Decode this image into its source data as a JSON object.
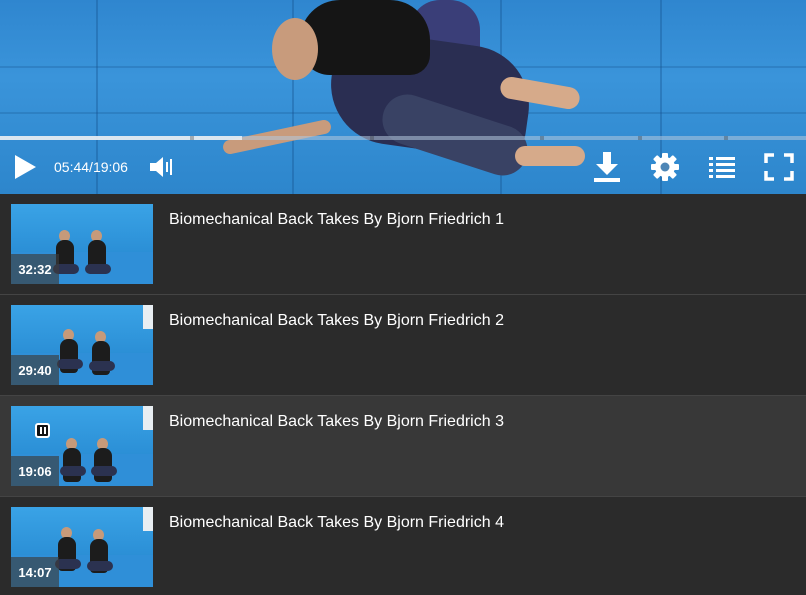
{
  "player": {
    "current_time": "05:44",
    "separator": "/",
    "total_time": "19:06",
    "progress": 0.3
  },
  "controls": {
    "play_icon": "play-icon",
    "volume_icon": "volume-icon",
    "download_icon": "download-icon",
    "settings_icon": "gear-icon",
    "playlist_icon": "list-icon",
    "fullscreen_icon": "fullscreen-icon"
  },
  "playlist": {
    "items": [
      {
        "title": "Biomechanical Back Takes By Bjorn Friedrich 1",
        "duration": "32:32",
        "active": false
      },
      {
        "title": "Biomechanical Back Takes By Bjorn Friedrich 2",
        "duration": "29:40",
        "active": false
      },
      {
        "title": "Biomechanical Back Takes By Bjorn Friedrich 3",
        "duration": "19:06",
        "active": true
      },
      {
        "title": "Biomechanical Back Takes By Bjorn Friedrich 4",
        "duration": "14:07",
        "active": false
      }
    ]
  }
}
